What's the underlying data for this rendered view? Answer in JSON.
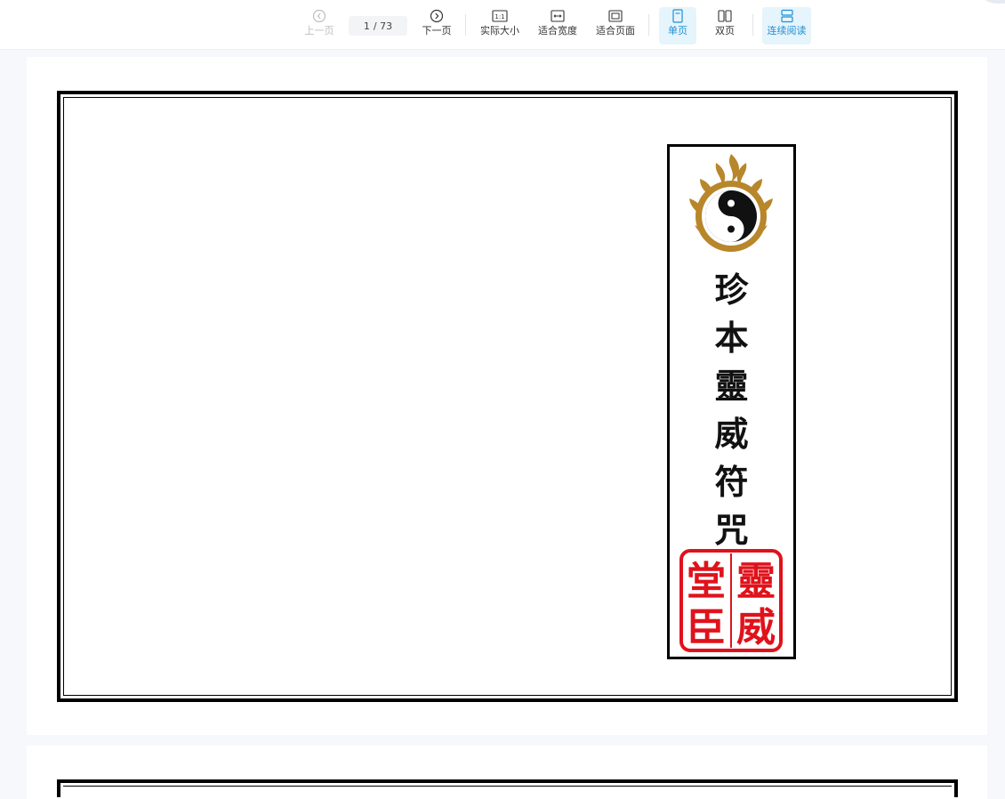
{
  "toolbar": {
    "prev_label": "上一页",
    "page_current": "1",
    "page_total": "/ 73",
    "next_label": "下一页",
    "actual_size_label": "实际大小",
    "fit_width_label": "适合宽度",
    "fit_page_label": "适合页面",
    "single_page_label": "单页",
    "double_page_label": "双页",
    "continuous_label": "连续阅读",
    "active_color": "#1e90d6"
  },
  "document": {
    "title_chars": [
      "珍",
      "本",
      "靈",
      "威",
      "符",
      "咒"
    ],
    "seal_chars": [
      "靈",
      "威",
      "堂",
      "臣"
    ],
    "seal_color": "#e0121b",
    "emblem_color": "#b8862b"
  }
}
